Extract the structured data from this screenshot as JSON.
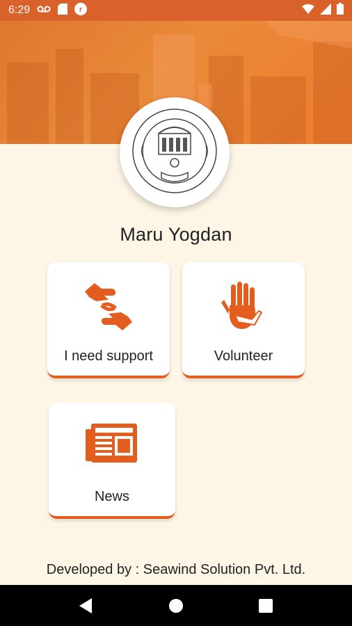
{
  "status_bar": {
    "time": "6:29",
    "icons": [
      "voicemail-icon",
      "sd-card-icon",
      "app-notification-icon",
      "wifi-icon",
      "cellular-icon",
      "battery-icon"
    ]
  },
  "colors": {
    "accent": "#e35d1e",
    "status_bar": "#d8622a",
    "background": "#fdf6e6"
  },
  "app": {
    "title": "Maru Yogdan",
    "logo_icon": "municipal-corporation-emblem-icon"
  },
  "cards": [
    {
      "label": "I need support",
      "icon": "helping-hands-icon"
    },
    {
      "label": "Volunteer",
      "icon": "raised-hands-icon"
    },
    {
      "label": "News",
      "icon": "newspaper-icon"
    }
  ],
  "footer": {
    "text": "Developed by : Seawind Solution Pvt. Ltd."
  },
  "nav_bar": {
    "icons": [
      "back-icon",
      "home-icon",
      "recents-icon"
    ]
  }
}
